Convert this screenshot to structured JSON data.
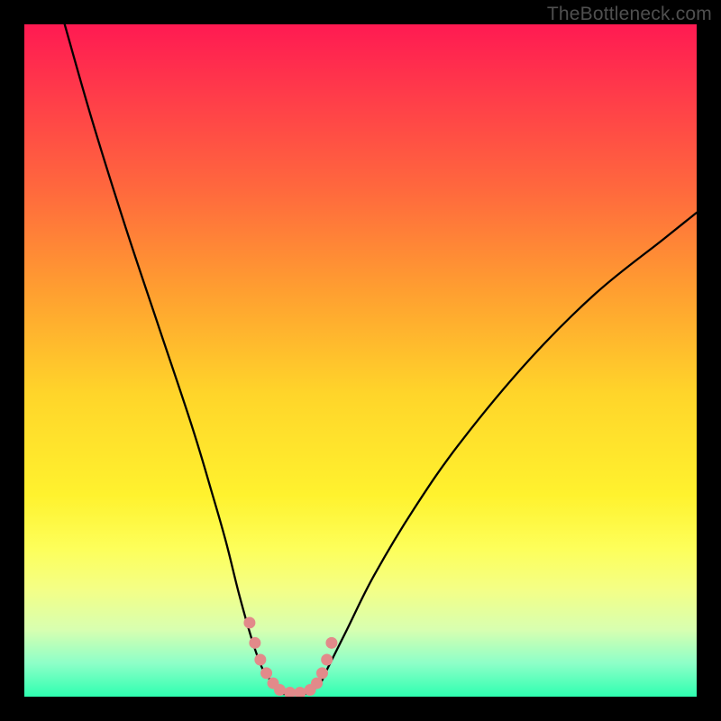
{
  "watermark": "TheBottleneck.com",
  "chart_data": {
    "type": "line",
    "title": "",
    "xlabel": "",
    "ylabel": "",
    "xlim": [
      0,
      100
    ],
    "ylim": [
      0,
      100
    ],
    "grid": false,
    "legend": false,
    "series": [
      {
        "name": "bottleneck-curve",
        "color": "#000000",
        "x": [
          6,
          10,
          15,
          20,
          25,
          28,
          30,
          32,
          34,
          35.5,
          37,
          38,
          40,
          42,
          44,
          45,
          48,
          52,
          58,
          65,
          75,
          85,
          95,
          100
        ],
        "y": [
          100,
          86,
          70,
          55,
          40,
          30,
          23,
          15,
          8,
          4,
          2,
          0.5,
          0.5,
          0.5,
          2,
          4,
          10,
          18,
          28,
          38,
          50,
          60,
          68,
          72
        ]
      },
      {
        "name": "dotted-anchor",
        "color": "#e28a8a",
        "style": "dots",
        "x": [
          33.5,
          34.3,
          35.1,
          36.0,
          37.0,
          38.0,
          39.5,
          41.0,
          42.5,
          43.5,
          44.3,
          45.0,
          45.7
        ],
        "y": [
          11,
          8,
          5.5,
          3.5,
          2,
          1,
          0.6,
          0.6,
          1,
          2,
          3.5,
          5.5,
          8
        ]
      }
    ],
    "gradient": {
      "top_color": "#ff1a52",
      "bottom_color": "#2effb0"
    }
  }
}
